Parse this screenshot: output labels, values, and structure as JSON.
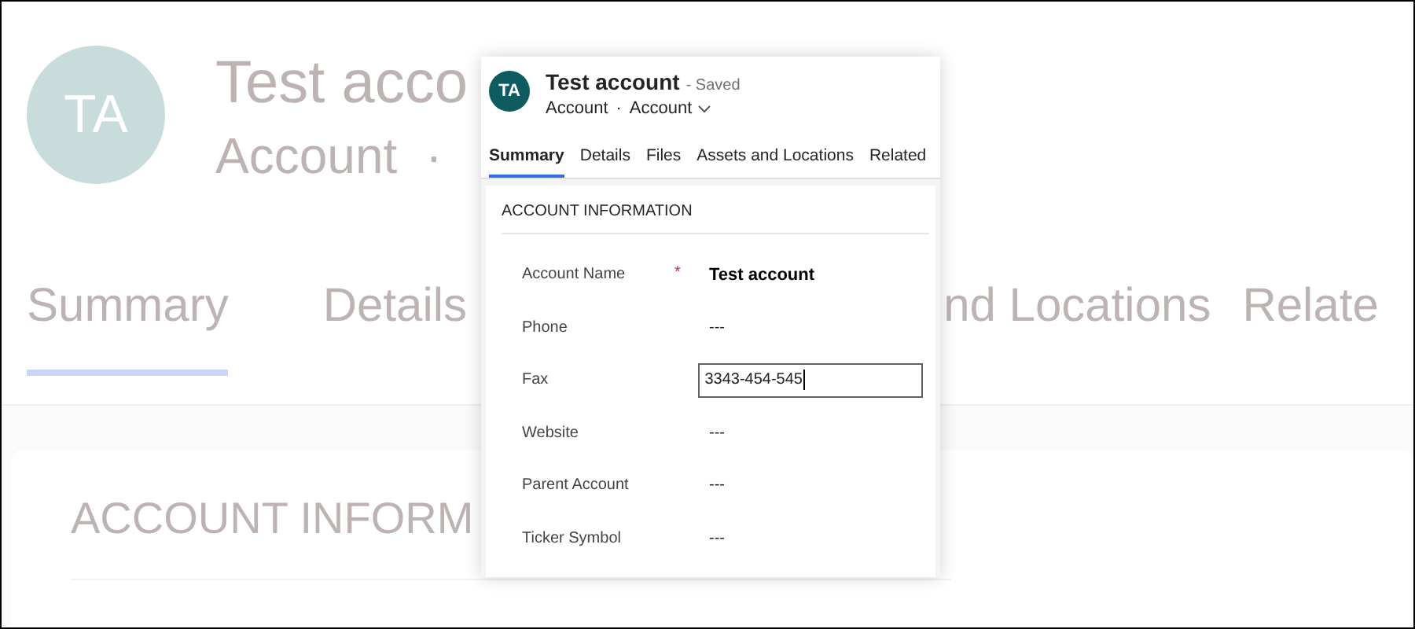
{
  "backdrop": {
    "avatar": "TA",
    "title": "Test acco",
    "entity": "Account",
    "separator": "·",
    "tabs": [
      {
        "label": "Summary",
        "selected": true
      },
      {
        "label": "Details",
        "selected": false
      },
      {
        "label": "nd Locations",
        "selected": false
      },
      {
        "label": "Relate",
        "selected": false
      }
    ],
    "section_title": "ACCOUNT INFORM"
  },
  "record": {
    "avatar": "TA",
    "title": "Test account",
    "save_status": "- Saved",
    "entity": "Account",
    "separator": "·",
    "form": "Account",
    "tabs": [
      {
        "label": "Summary",
        "selected": true
      },
      {
        "label": "Details",
        "selected": false
      },
      {
        "label": "Files",
        "selected": false
      },
      {
        "label": "Assets and Locations",
        "selected": false
      },
      {
        "label": "Related",
        "selected": false
      }
    ],
    "section": {
      "title": "ACCOUNT INFORMATION",
      "fields": [
        {
          "label": "Account Name",
          "required_mark": "*",
          "kind": "bold",
          "value": "Test account"
        },
        {
          "label": "Phone",
          "kind": "plain",
          "value": "---"
        },
        {
          "label": "Fax",
          "kind": "input",
          "value": "3343-454-545"
        },
        {
          "label": "Website",
          "kind": "plain",
          "value": "---"
        },
        {
          "label": "Parent Account",
          "kind": "plain",
          "value": "---"
        },
        {
          "label": "Ticker Symbol",
          "kind": "plain",
          "value": "---"
        }
      ]
    }
  }
}
